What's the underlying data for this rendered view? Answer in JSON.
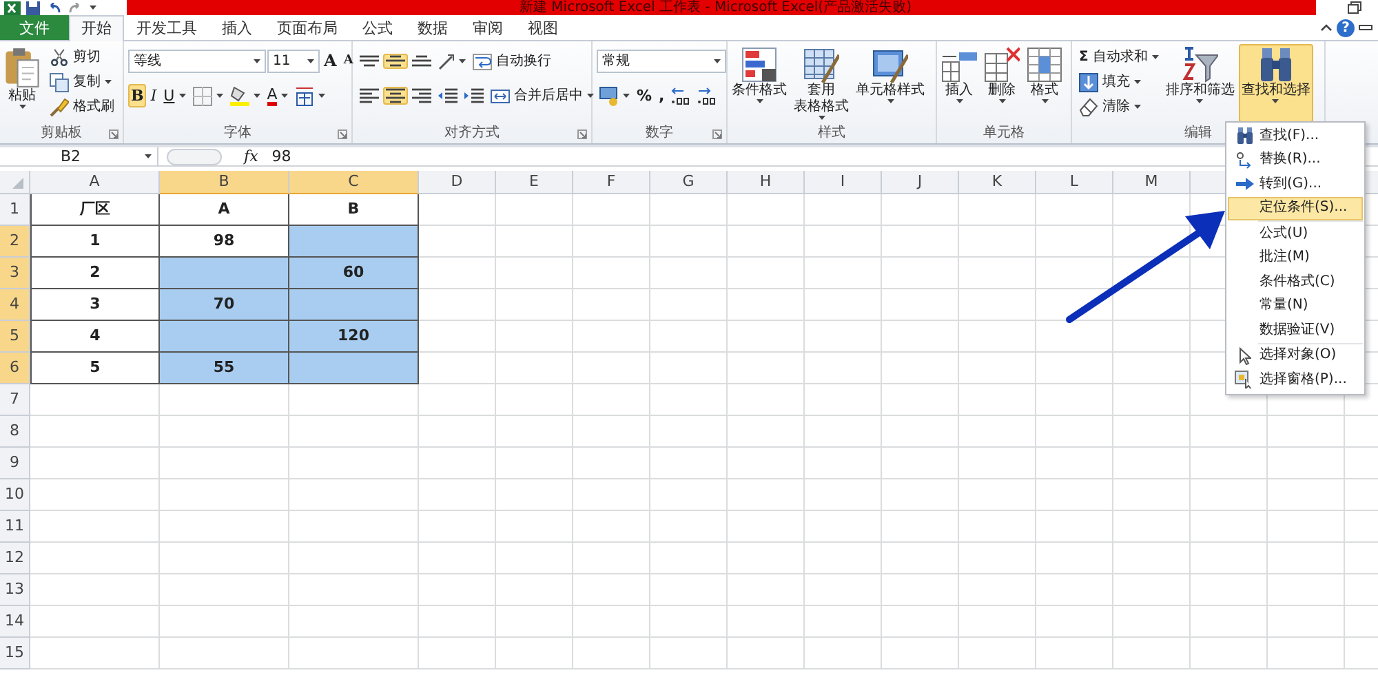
{
  "window": {
    "title": "新建 Microsoft Excel 工作表 - Microsoft Excel(产品激活失败)",
    "help": "?"
  },
  "tabs": [
    {
      "label": "文件",
      "kind": "file",
      "selected": false
    },
    {
      "label": "开始",
      "kind": "tab",
      "selected": true
    },
    {
      "label": "开发工具",
      "kind": "tab",
      "selected": false
    },
    {
      "label": "插入",
      "kind": "tab",
      "selected": false
    },
    {
      "label": "页面布局",
      "kind": "tab",
      "selected": false
    },
    {
      "label": "公式",
      "kind": "tab",
      "selected": false
    },
    {
      "label": "数据",
      "kind": "tab",
      "selected": false
    },
    {
      "label": "审阅",
      "kind": "tab",
      "selected": false
    },
    {
      "label": "视图",
      "kind": "tab",
      "selected": false
    }
  ],
  "ribbon": {
    "groups": [
      {
        "label": "剪贴板",
        "launcher": true,
        "items": [
          {
            "kind": "large",
            "lines": [
              "粘贴"
            ],
            "dropdown": true,
            "on": false
          },
          {
            "kind": "stack",
            "lines": [
              {
                "controls": [
                  {
                    "kind": "small",
                    "label": "剪切"
                  }
                ]
              },
              {
                "controls": [
                  {
                    "kind": "small",
                    "label": "复制",
                    "dropdown": true
                  }
                ]
              },
              {
                "controls": [
                  {
                    "kind": "small",
                    "label": "格式刷"
                  }
                ]
              }
            ]
          }
        ]
      },
      {
        "label": "字体",
        "launcher": true,
        "items": [
          {
            "kind": "stack",
            "lines": [
              {
                "controls": [
                  {
                    "kind": "field",
                    "value": "等线"
                  },
                  {
                    "kind": "field",
                    "value": "11"
                  },
                  {
                    "kind": "grow",
                    "label": "A",
                    "on": false
                  },
                  {
                    "kind": "shrink",
                    "label": "A",
                    "on": false
                  }
                ]
              },
              {
                "controls": [
                  {
                    "kind": "bold",
                    "label": "B",
                    "on": true
                  },
                  {
                    "kind": "italic",
                    "label": "I",
                    "on": false
                  },
                  {
                    "kind": "underline",
                    "label": "U",
                    "on": false,
                    "dropdown": true
                  },
                  {
                    "kind": "icon",
                    "on": false,
                    "dropdown": true
                  },
                  {
                    "kind": "icon",
                    "on": false,
                    "dropdown": true
                  },
                  {
                    "kind": "color",
                    "label": "A",
                    "on": false,
                    "dropdown": true
                  },
                  {
                    "kind": "icon",
                    "on": false,
                    "dropdown": true
                  }
                ]
              }
            ]
          }
        ]
      },
      {
        "label": "对齐方式",
        "launcher": true,
        "items": [
          {
            "kind": "stack",
            "lines": [
              {
                "controls": [
                  {
                    "kind": "icon",
                    "on": false
                  },
                  {
                    "kind": "icon",
                    "on": true
                  },
                  {
                    "kind": "icon",
                    "on": false
                  },
                  {
                    "kind": "icon",
                    "on": false,
                    "dropdown": true
                  },
                  {
                    "kind": "small",
                    "label": "自动换行"
                  }
                ]
              },
              {
                "controls": [
                  {
                    "kind": "icon",
                    "on": false
                  },
                  {
                    "kind": "icon",
                    "on": true
                  },
                  {
                    "kind": "icon",
                    "on": false
                  },
                  {
                    "kind": "icon",
                    "on": false
                  },
                  {
                    "kind": "icon",
                    "on": false
                  },
                  {
                    "kind": "small",
                    "label": "合并后居中",
                    "dropdown": true
                  }
                ]
              }
            ]
          }
        ]
      },
      {
        "label": "数字",
        "launcher": true,
        "items": [
          {
            "kind": "stack",
            "lines": [
              {
                "controls": [
                  {
                    "kind": "field",
                    "value": "常规"
                  }
                ]
              },
              {
                "controls": [
                  {
                    "kind": "icon",
                    "on": false,
                    "dropdown": true
                  },
                  {
                    "kind": "char",
                    "label": "%"
                  },
                  {
                    "kind": "char",
                    "label": ","
                  },
                  {
                    "kind": "icon",
                    "on": false
                  },
                  {
                    "kind": "icon",
                    "on": false
                  }
                ]
              }
            ]
          }
        ]
      },
      {
        "label": "样式",
        "items": [
          {
            "kind": "large",
            "lines": [
              "条件格式"
            ],
            "dropdown": true,
            "on": false
          },
          {
            "kind": "large",
            "lines": [
              "套用",
              "表格格式"
            ],
            "dropdown": true,
            "on": false
          },
          {
            "kind": "large",
            "lines": [
              "单元格样式"
            ],
            "dropdown": true,
            "on": false
          }
        ]
      },
      {
        "label": "单元格",
        "items": [
          {
            "kind": "large",
            "lines": [
              "插入"
            ],
            "dropdown": true,
            "on": false
          },
          {
            "kind": "large",
            "lines": [
              "删除"
            ],
            "dropdown": true,
            "on": false
          },
          {
            "kind": "large",
            "lines": [
              "格式"
            ],
            "dropdown": true,
            "on": false
          }
        ]
      },
      {
        "label": "编辑",
        "items": [
          {
            "kind": "stack",
            "lines": [
              {
                "controls": [
                  {
                    "kind": "small",
                    "glyph": "Σ",
                    "label": "自动求和",
                    "dropdown": true
                  }
                ]
              },
              {
                "controls": [
                  {
                    "kind": "small",
                    "label": "填充",
                    "dropdown": true
                  }
                ]
              },
              {
                "controls": [
                  {
                    "kind": "small",
                    "label": "清除",
                    "dropdown": true
                  }
                ]
              }
            ]
          },
          {
            "kind": "large",
            "lines": [
              "排序和筛选"
            ],
            "dropdown": true,
            "on": false
          },
          {
            "kind": "large",
            "lines": [
              "查找和选择"
            ],
            "dropdown": true,
            "on": true
          }
        ]
      }
    ]
  },
  "formula_bar": {
    "name_box": "B2",
    "fx": "fx",
    "value": "98"
  },
  "sheet": {
    "columns": [
      {
        "label": "A",
        "selected": false
      },
      {
        "label": "B",
        "selected": true
      },
      {
        "label": "C",
        "selected": true
      },
      {
        "label": "D",
        "selected": false
      },
      {
        "label": "E",
        "selected": false
      },
      {
        "label": "F",
        "selected": false
      },
      {
        "label": "G",
        "selected": false
      },
      {
        "label": "H",
        "selected": false
      },
      {
        "label": "I",
        "selected": false
      },
      {
        "label": "J",
        "selected": false
      },
      {
        "label": "K",
        "selected": false
      },
      {
        "label": "L",
        "selected": false
      },
      {
        "label": "M",
        "selected": false
      }
    ],
    "rows": [
      {
        "label": "1",
        "selected": false,
        "cells": [
          {
            "text": "厂区",
            "selected": false
          },
          {
            "text": "A",
            "selected": false
          },
          {
            "text": "B",
            "selected": false
          }
        ]
      },
      {
        "label": "2",
        "selected": true,
        "cells": [
          {
            "text": "1",
            "selected": false
          },
          {
            "text": "98",
            "selected": false
          },
          {
            "selected": true
          }
        ]
      },
      {
        "label": "3",
        "selected": true,
        "cells": [
          {
            "text": "2",
            "selected": false
          },
          {
            "selected": true
          },
          {
            "text": "60",
            "selected": true
          }
        ]
      },
      {
        "label": "4",
        "selected": true,
        "cells": [
          {
            "text": "3",
            "selected": false
          },
          {
            "text": "70",
            "selected": true
          },
          {
            "selected": true
          }
        ]
      },
      {
        "label": "5",
        "selected": true,
        "cells": [
          {
            "text": "4",
            "selected": false
          },
          {
            "selected": true
          },
          {
            "text": "120",
            "selected": true
          }
        ]
      },
      {
        "label": "6",
        "selected": true,
        "cells": [
          {
            "text": "5",
            "selected": false
          },
          {
            "text": "55",
            "selected": true
          },
          {
            "selected": true
          }
        ]
      },
      {
        "label": "7",
        "selected": false
      },
      {
        "label": "8",
        "selected": false
      },
      {
        "label": "9",
        "selected": false
      },
      {
        "label": "10",
        "selected": false
      },
      {
        "label": "11",
        "selected": false
      },
      {
        "label": "12",
        "selected": false
      },
      {
        "label": "13",
        "selected": false
      },
      {
        "label": "14",
        "selected": false
      },
      {
        "label": "15",
        "selected": false
      }
    ]
  },
  "menu": {
    "sections": [
      [
        {
          "label": "查找(F)...",
          "kind": "find",
          "selected": false
        },
        {
          "label": "替换(R)...",
          "kind": "replace",
          "selected": false
        },
        {
          "label": "转到(G)...",
          "kind": "goto",
          "selected": false
        },
        {
          "label": "定位条件(S)...",
          "kind": "plain",
          "selected": true
        }
      ],
      [
        {
          "label": "公式(U)",
          "kind": "plain",
          "selected": false
        },
        {
          "label": "批注(M)",
          "kind": "plain",
          "selected": false
        },
        {
          "label": "条件格式(C)",
          "kind": "plain",
          "selected": false
        },
        {
          "label": "常量(N)",
          "kind": "plain",
          "selected": false
        },
        {
          "label": "数据验证(V)",
          "kind": "plain",
          "selected": false
        }
      ],
      [
        {
          "label": "选择对象(O)",
          "kind": "pointer",
          "selected": false
        },
        {
          "label": "选择窗格(P)...",
          "kind": "pane",
          "selected": false
        }
      ]
    ]
  }
}
